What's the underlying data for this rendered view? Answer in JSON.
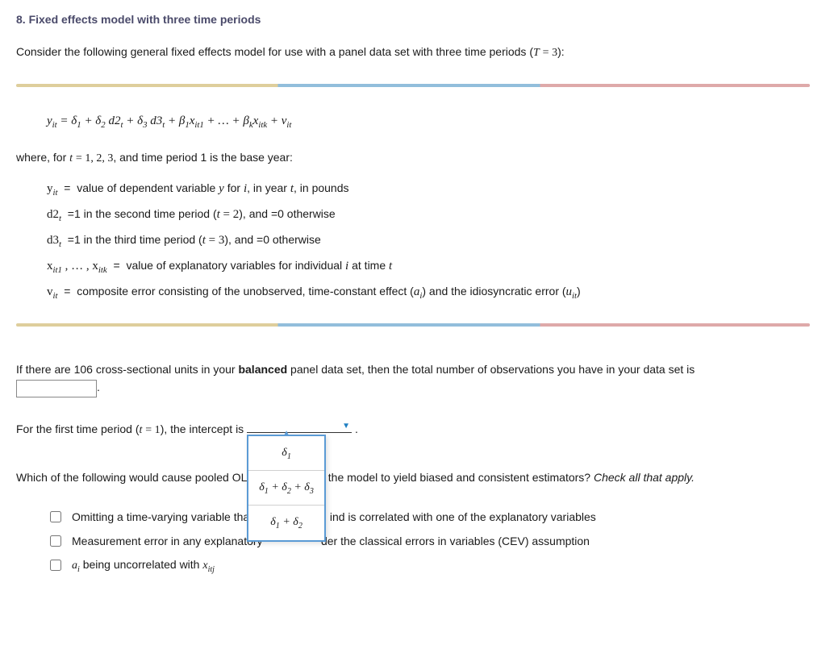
{
  "title": "8. Fixed effects model with three time periods",
  "intro": "Consider the following general fixed effects model for use with a panel data set with three time periods (T = 3):",
  "equation_html": "y<span class='sub'>it</span> = δ<span class='sub'>1</span> + δ<span class='sub'>2</span> d2<span class='sub'>t</span> + δ<span class='sub'>3</span> d3<span class='sub'>t</span> + β<span class='sub'>1</span>x<span class='sub'>it1</span> + … + β<span class='sub'>k</span>x<span class='sub'>itk</span> + v<span class='sub'>it</span>",
  "where_line": "where, for t = 1, 2, 3, and time period 1 is the base year:",
  "defs": {
    "d1": "y<span class='sub ital'>it</span><span class='txtpart'> &nbsp;=&nbsp; value of dependent variable </span><span class='ital'>y</span><span class='txtpart'> for </span><span class='ital'>i</span><span class='txtpart'>, in year </span><span class='ital'>t</span><span class='txtpart'>, in pounds</span>",
    "d2": "d2<span class='sub ital'>t</span><span class='txtpart'> &nbsp;=1 in the second time period (</span><span class='ital'>t</span> = 2<span class='txtpart'>), and =0 otherwise</span>",
    "d3": "d3<span class='sub ital'>t</span><span class='txtpart'> &nbsp;=1 in the third time period (</span><span class='ital'>t</span> = 3<span class='txtpart'>), and =0 otherwise</span>",
    "d4": "x<span class='sub ital'>it1</span> , … , x<span class='sub ital'>itk</span><span class='txtpart'> &nbsp;=&nbsp; value of explanatory variables for individual </span><span class='ital'>i</span><span class='txtpart'> at time </span><span class='ital'>t</span>",
    "d5": "v<span class='sub ital'>it</span><span class='txtpart'> &nbsp;=&nbsp; composite error consisting of the unobserved, time-constant effect (</span><span class='ital'>a<span class='sub'>i</span></span><span class='txtpart'>) and the idiosyncratic error (</span><span class='ital'>u<span class='sub'>it</span></span><span class='txtpart'>)</span>"
  },
  "q1_pre": "If there are 106 cross-sectional units in your ",
  "q1_bold": "balanced",
  "q1_post": " panel data set, then the total number of observations you have in your data set is",
  "q1_input_value": "",
  "q1_suffix": ".",
  "q2_pre": "For the first time period (",
  "q2_t": "t = 1",
  "q2_mid": "), the intercept is ",
  "q2_suffix": " .",
  "dropdown_opts": {
    "o1": "δ<span class='sub'>1</span>",
    "o2": "δ<span class='sub'>1</span> + δ<span class='sub'>2</span> + δ<span class='sub'>3</span>",
    "o3": "δ<span class='sub'>1</span> + δ<span class='sub'>2</span>"
  },
  "q3_pre": "Which of the following would cause pooled OLS estimation of the model to yield biased and consistent estimators? ",
  "q3_instr": "Check all that apply.",
  "opts": {
    "o1": "Omitting a time-varying variable that changes over time and is correlated with one of the explanatory variables",
    "o2": "Measurement error in any explanatory variable under the classical errors in variables (CEV) assumption",
    "o3_html": "<span class='ital serif'>a<span class='sub'>i</span></span> being uncorrelated with <span class='ital serif'>x<span class='sub'>itj</span></span>"
  }
}
